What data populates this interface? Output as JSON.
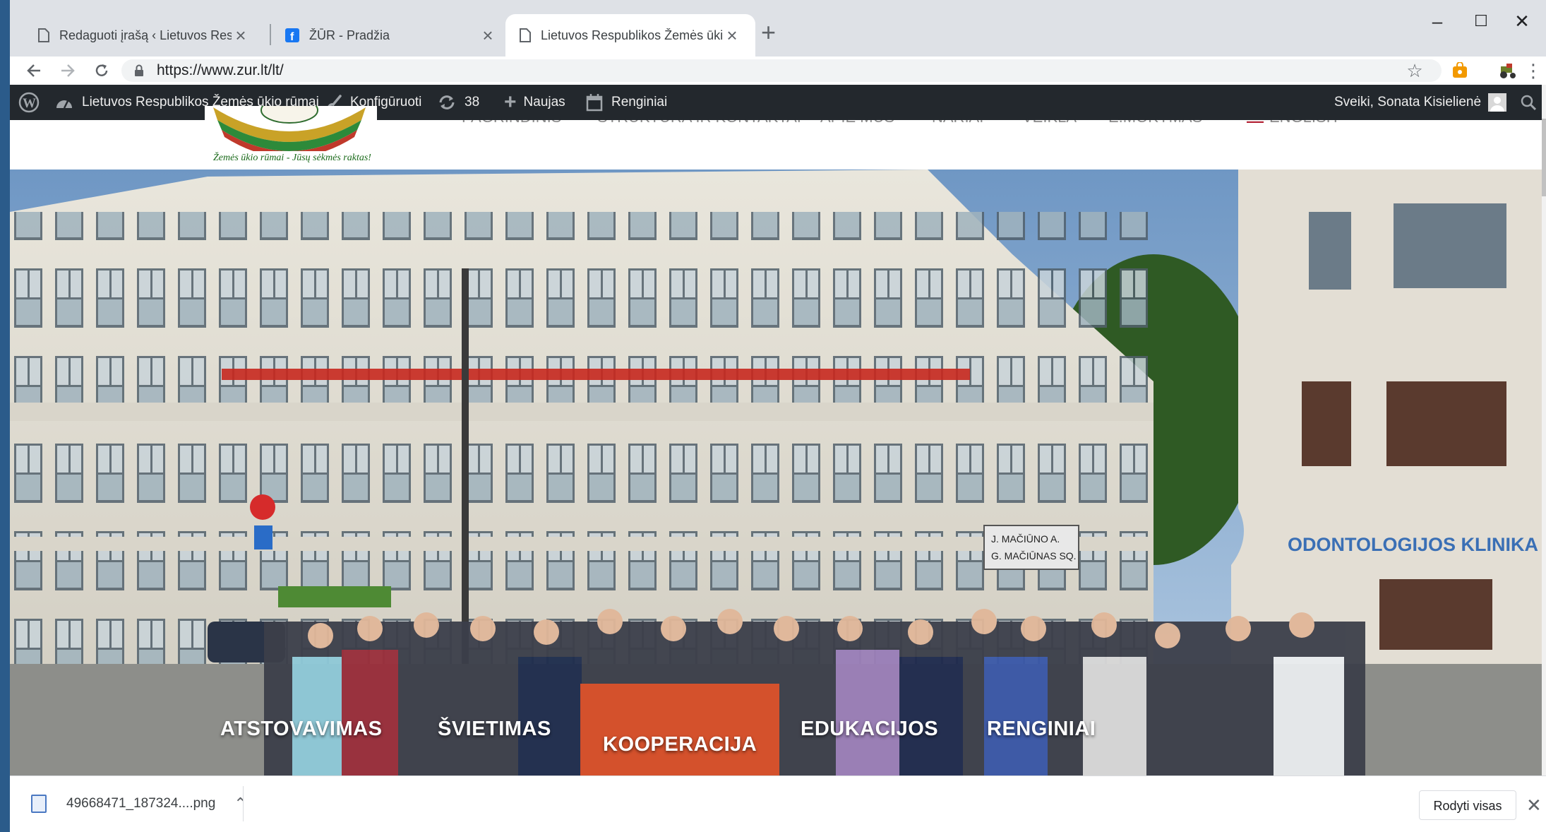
{
  "browser": {
    "tabs": [
      {
        "title": "Redaguoti įrašą ‹ Lietuvos Respublikos Žemės ūkio rūmai",
        "active": false,
        "icon": "page-icon"
      },
      {
        "title": "ŽŪR - Pradžia",
        "active": false,
        "icon": "facebook-icon"
      },
      {
        "title": "Lietuvos Respublikos Žemės ūkio rūmai",
        "active": true,
        "icon": "page-icon"
      }
    ],
    "new_tab": "+",
    "url": "https://www.zur.lt/lt/",
    "window_controls": {
      "minimize": "–",
      "maximize": "☐",
      "close": "✕"
    }
  },
  "adminbar": {
    "site_name": "Lietuvos Respublikos Žemės ūkio rūmai",
    "customize": "Konfigūruoti",
    "updates_count": "38",
    "new": "Naujas",
    "events": "Renginiai",
    "greeting": "Sveiki, Sonata Kisielienė"
  },
  "site": {
    "logo_tagline": "Žemės ūkio rūmai - Jūsų sėkmės raktas!",
    "nav": [
      "PAGRINDINIS",
      "STRUKTŪRA IR KONTAKTAI",
      "APIE MUS",
      "NARIAI",
      "VEIKLA",
      "E.MOKYMAS",
      "ENGLISH"
    ]
  },
  "hero_menu": [
    {
      "label": "ATSTOVAVIMAS",
      "active": false
    },
    {
      "label": "ŠVIETIMAS",
      "active": false
    },
    {
      "label": "KOOPERACIJA",
      "active": true
    },
    {
      "label": "EDUKACIJOS",
      "active": false
    },
    {
      "label": "RENGINIAI",
      "active": false
    }
  ],
  "hero_signs": {
    "clinic": "ODONTOLOGIJOS KLINIKA",
    "street_1": "J. MAČIŪNO A.",
    "street_2": "G. MAČIŪNAS SQ."
  },
  "download": {
    "filename": "49668471_187324....png",
    "show_all": "Rodyti visas"
  },
  "colors": {
    "adminbar_bg": "#23282d",
    "accent": "#e0532a",
    "tab_strip": "#dee1e6"
  }
}
